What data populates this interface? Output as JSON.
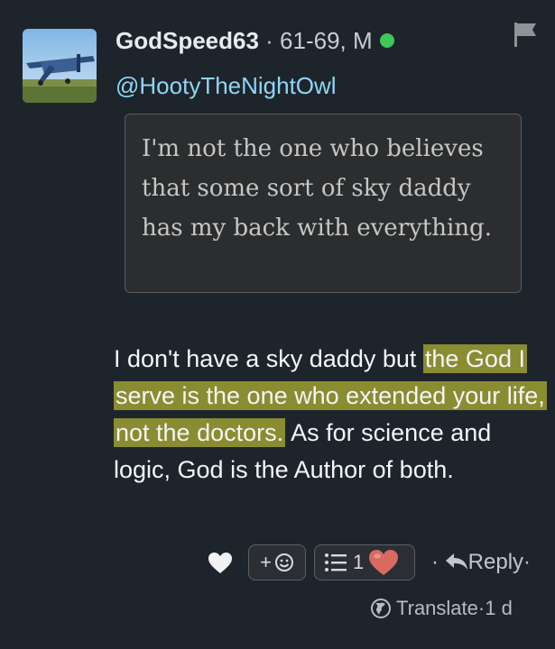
{
  "post": {
    "author": "GodSpeed63",
    "meta_sep": " · ",
    "meta": "61-69, M",
    "mention": "@HootyTheNightOwl",
    "quote": "I'm not the one who believes that some sort of sky daddy has my back with everything.",
    "body_plain_1": "I don't have a sky daddy but ",
    "body_highlight": "the God I serve is the one who extended your life, not the doctors.",
    "body_plain_2": " As for science and logic, God is the Author of both."
  },
  "actions": {
    "emoji_plus": "+",
    "reaction_count": "1",
    "reply_label": "Reply",
    "reply_prefix": "·",
    "reply_suffix": "·"
  },
  "footer": {
    "translate_label": "Translate",
    "sep": " · ",
    "time": "1 d"
  },
  "colors": {
    "background": "#1e242c",
    "mention": "#8fd6f5",
    "online": "#3fc75a",
    "highlight": "#cdcd37",
    "heart_reaction": "#d96a5f"
  },
  "icons": {
    "flag": "flag-icon",
    "heart": "heart-icon",
    "emoji": "smiley-icon",
    "list": "list-icon",
    "reply": "reply-arrow-icon",
    "globe": "globe-icon"
  }
}
